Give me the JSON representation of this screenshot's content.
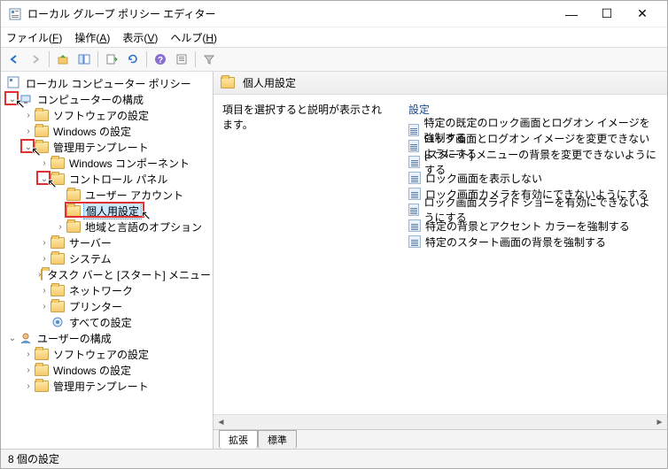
{
  "window": {
    "title": "ローカル グループ ポリシー エディター"
  },
  "menubar": {
    "file": "ファイル(F)",
    "action": "操作(A)",
    "view": "表示(V)",
    "help": "ヘルプ(H)"
  },
  "tree": {
    "root": "ローカル コンピューター ポリシー",
    "computer": "コンピューターの構成",
    "software": "ソフトウェアの設定",
    "windows": "Windows の設定",
    "admin": "管理用テンプレート",
    "wincomp": "Windows コンポーネント",
    "cpanel": "コントロール パネル",
    "useracc": "ユーザー アカウント",
    "personal": "個人用設定",
    "region": "地域と言語のオプション",
    "server": "サーバー",
    "system": "システム",
    "taskbar": "タスク バーと [スタート] メニュー",
    "network": "ネットワーク",
    "printer": "プリンター",
    "allset": "すべての設定",
    "user": "ユーザーの構成",
    "usoftware": "ソフトウェアの設定",
    "uwindows": "Windows の設定",
    "uadmin": "管理用テンプレート"
  },
  "content": {
    "header": "個人用設定",
    "prompt": "項目を選択すると説明が表示されます。",
    "col_settings": "設定",
    "items": [
      "特定の既定のロック画面とログオン イメージを強制する",
      "ロック画面とログオン イメージを変更できないようにする",
      "[スタート] メニューの背景を変更できないようにする",
      "ロック画面を表示しない",
      "ロック画面カメラを有効にできないようにする",
      "ロック画面スライド ショーを有効にできないようにする",
      "特定の背景とアクセント カラーを強制する",
      "特定のスタート画面の背景を強制する"
    ]
  },
  "tabs": {
    "extended": "拡張",
    "standard": "標準"
  },
  "statusbar": "8 個の設定"
}
